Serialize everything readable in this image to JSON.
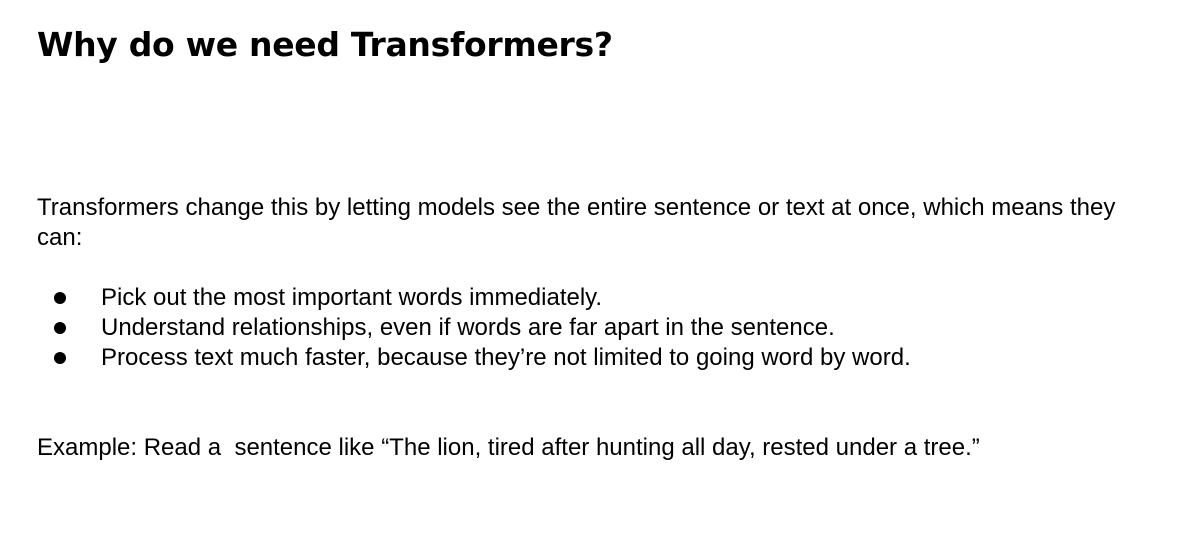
{
  "slide": {
    "title": "Why do we need Transformers?",
    "intro": "Transformers change this by letting models see the entire sentence or text at once, which means they can:",
    "bullets": [
      "Pick out the most important words immediately.",
      "Understand relationships, even if words are far apart in the sentence.",
      "Process text much faster, because they’re not limited to going word by word."
    ],
    "example": "Example: Read a  sentence like “The lion, tired after hunting all day, rested under a tree.”"
  }
}
